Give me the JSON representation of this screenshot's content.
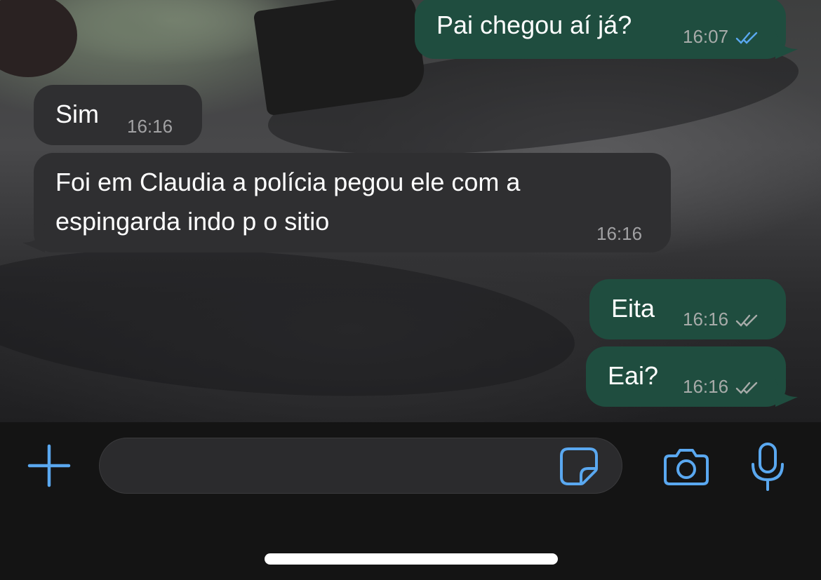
{
  "colors": {
    "incoming_bubble": "#2f2f31",
    "outgoing_bubble": "#1f4d3f",
    "read_ticks": "#5aa8f0",
    "delivered_ticks": "#a7aba9",
    "accent_icons": "#5aa8f0",
    "composer_bar": "#141414"
  },
  "messages": [
    {
      "direction": "outgoing",
      "text": "Pai chegou aí já?",
      "time": "16:07",
      "status": "read"
    },
    {
      "direction": "incoming",
      "text": "Sim",
      "time": "16:16"
    },
    {
      "direction": "incoming",
      "text_lines": [
        "Foi em Claudia a polícia pegou ele com a",
        "espingarda indo p o sitio"
      ],
      "time": "16:16"
    },
    {
      "direction": "outgoing",
      "text": "Eita",
      "time": "16:16",
      "status": "delivered"
    },
    {
      "direction": "outgoing",
      "text": "Eai?",
      "time": "16:16",
      "status": "delivered"
    }
  ],
  "composer": {
    "value": "",
    "icons": {
      "attach": "plus-icon",
      "sticker": "sticker-icon",
      "camera": "camera-icon",
      "microphone": "microphone-icon"
    }
  }
}
